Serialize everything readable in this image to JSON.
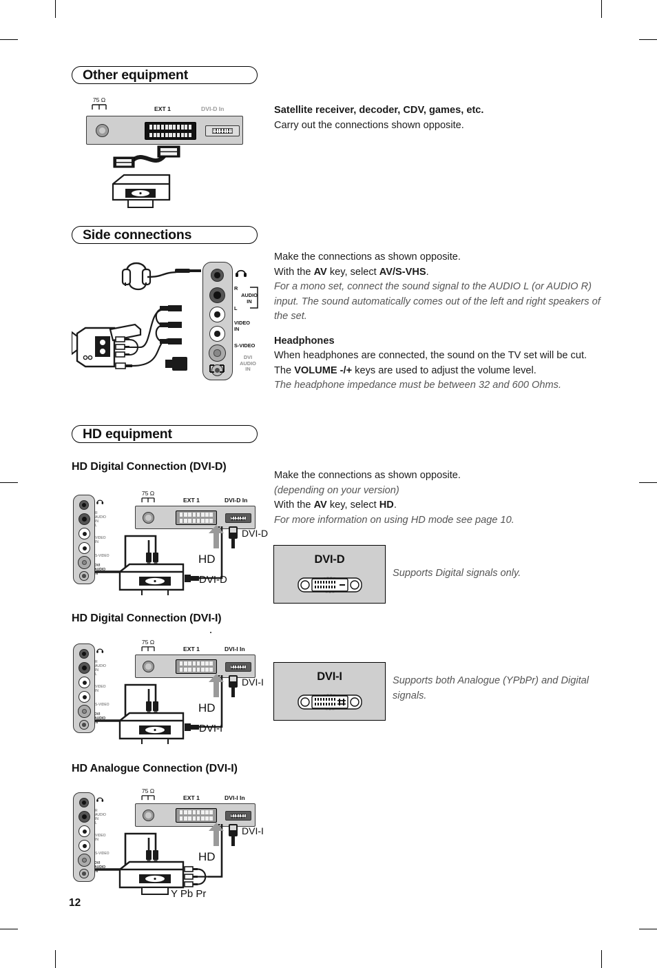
{
  "page": {
    "number": "12"
  },
  "sections": [
    {
      "id": "other-equipment",
      "title": "Other equipment"
    },
    {
      "id": "side-connections",
      "title": "Side connections"
    },
    {
      "id": "hd-equipment",
      "title": "HD equipment"
    }
  ],
  "other_equipment": {
    "heading": "Satellite receiver, decoder, CDV, games, etc.",
    "body": "Carry out the connections shown opposite.",
    "panel": {
      "antenna_label": "75 Ω",
      "ext_label": "EXT 1",
      "dvi_label": "DVI-D In"
    }
  },
  "side_connections": {
    "line1": "Make the connections as shown opposite.",
    "line2_pre": "With the ",
    "line2_key": "AV",
    "line2_mid": " key, select ",
    "line2_val": "AV/S-VHS",
    "line2_end": ".",
    "italic": "For a mono set, connect the sound signal to the AUDIO L (or AUDIO R) input. The sound automatically comes out of the left and right speakers of the set.",
    "headphones_title": "Headphones",
    "headphones_body_pre": "When headphones are connected, the sound on the TV set will be cut. The ",
    "headphones_body_key": "VOLUME -/+",
    "headphones_body_post": " keys are used to adjust the volume level.",
    "headphones_italic": "The headphone impedance must be between 32 and 600 Ohms.",
    "jacks": [
      {
        "name": "headphone-jack",
        "label": "",
        "icon": "headphone-icon"
      },
      {
        "name": "audio-in-r",
        "label": "R"
      },
      {
        "name": "audio-in-group",
        "label": "AUDIO IN"
      },
      {
        "name": "audio-in-l",
        "label": "L"
      },
      {
        "name": "video-in",
        "label": "VIDEO IN"
      },
      {
        "name": "s-video",
        "label": "S-VIDEO"
      },
      {
        "name": "dvi-audio-in",
        "label": "DVI AUDIO IN"
      }
    ]
  },
  "hd_equipment": {
    "line1": "Make the connections as shown opposite.",
    "line2_italic": "(depending on your version)",
    "line3_pre": "With the ",
    "line3_key": "AV",
    "line3_mid": " key, select ",
    "line3_val": "HD",
    "line3_end": ".",
    "line4_italic": "For more information on using HD mode see page 10.",
    "subsections": [
      {
        "title": "HD Digital Connection (DVI-D)",
        "panel_dvi": "DVI-D In",
        "arrow_label": "DVI-D",
        "device": "HD",
        "device_out": "DVI-D"
      },
      {
        "title": "HD Digital Connection (DVI-I)",
        "panel_dvi": "DVI-I In",
        "arrow_label": "DVI-I",
        "device": "HD",
        "device_out": "DVI-I"
      },
      {
        "title": "HD Analogue Connection (DVI-I)",
        "panel_dvi": "DVI-I In",
        "arrow_label": "DVI-I",
        "device": "HD",
        "device_out": "Y Pb Pr"
      }
    ],
    "panel_common": {
      "antenna_label": "75 Ω",
      "ext_label": "EXT 1"
    },
    "dvi_cards": [
      {
        "title": "DVI-D",
        "caption": "Supports Digital signals only."
      },
      {
        "title": "DVI-I",
        "caption": "Supports both Analogue (YPbPr) and Digital signals."
      }
    ]
  },
  "colors": {
    "panel_gray": "#cfcfcf",
    "ink": "#1a1a1a",
    "muted": "#9b9b9b",
    "arrow_gray": "#9a9a9a"
  }
}
